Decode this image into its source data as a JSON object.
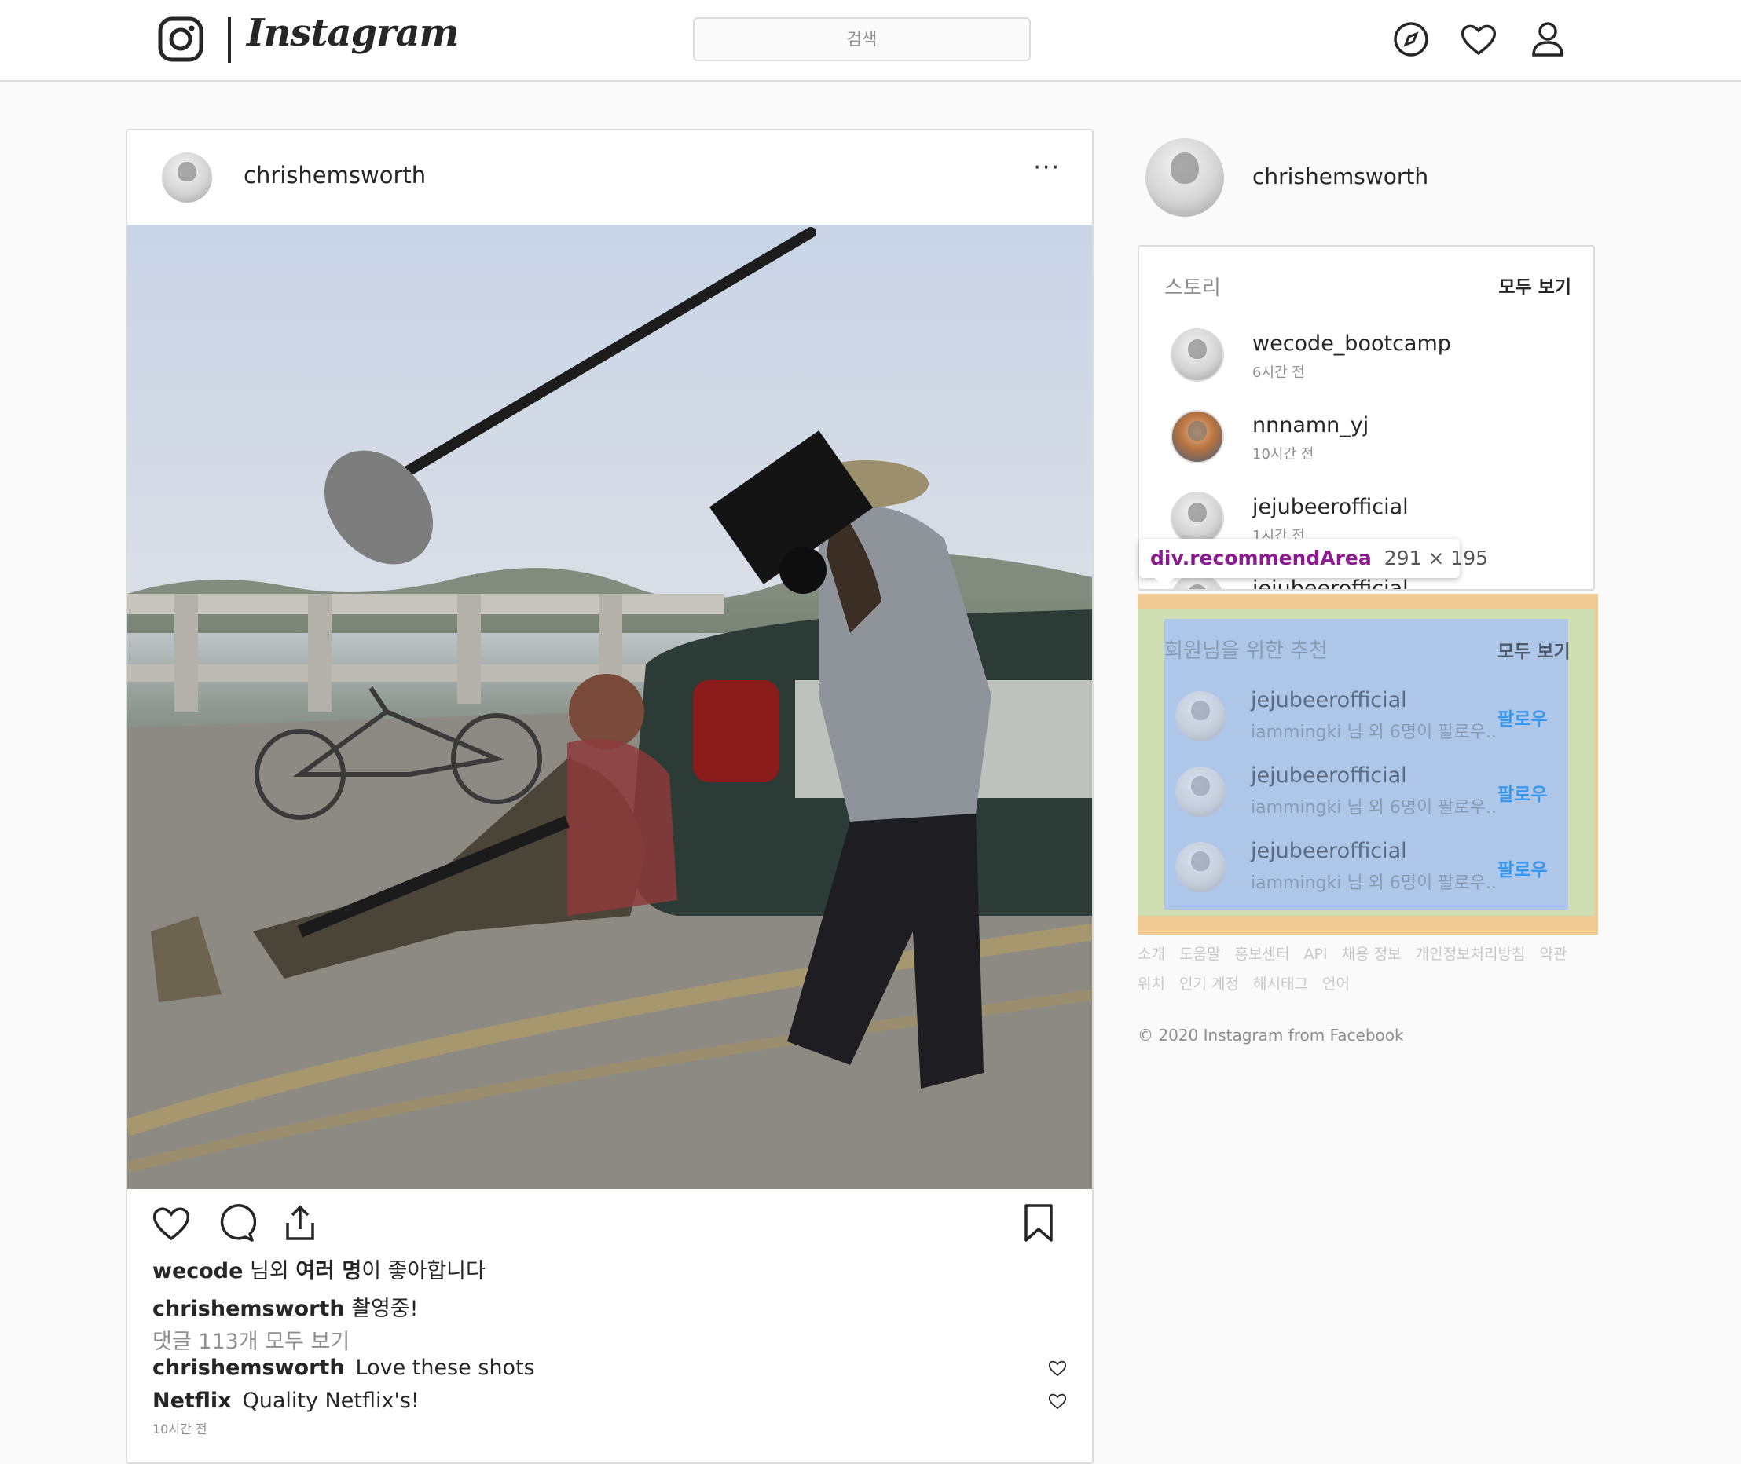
{
  "nav": {
    "logo_text": "Instagram",
    "search_placeholder": "검색",
    "icons": [
      "compass-icon",
      "heart-icon",
      "user-icon"
    ]
  },
  "feed": {
    "username": "chrishemsworth",
    "more": "···",
    "likes": {
      "user": "wecode",
      "mid": " 님외 ",
      "bold": "여러 명",
      "end": "이 좋아합니다"
    },
    "caption": {
      "user": "chrishemsworth",
      "text": " 촬영중!"
    },
    "view_comments": "댓글 113개 모두 보기",
    "comments": [
      {
        "user": "chrishemsworth",
        "text": "Love these shots"
      },
      {
        "user": "Netflix",
        "text": "Quality Netflix's!"
      }
    ],
    "time": "10시간 전"
  },
  "sidebar": {
    "username": "chrishemsworth",
    "stories": {
      "title": "스토리",
      "see_all": "모두 보기",
      "items": [
        {
          "name": "wecode_bootcamp",
          "time": "6시간 전"
        },
        {
          "name": "nnnamn_yj",
          "time": "10시간 전"
        },
        {
          "name": "jejubeerofficial",
          "time": "1시간 전"
        },
        {
          "name": "jejubeerofficial",
          "time": ""
        }
      ]
    },
    "tooltip": {
      "tag": "div.recommendArea",
      "dims": "291 × 195"
    },
    "recommend": {
      "title": "회원님을 위한 추천",
      "see_all": "모두 보기",
      "items": [
        {
          "name": "jejubeerofficial",
          "sub": "iammingki 님 외 6명이 팔로우..",
          "follow": "팔로우"
        },
        {
          "name": "jejubeerofficial",
          "sub": "iammingki 님 외 6명이 팔로우..",
          "follow": "팔로우"
        },
        {
          "name": "jejubeerofficial",
          "sub": "iammingki 님 외 6명이 팔로우..",
          "follow": "팔로우"
        }
      ]
    },
    "footer_links": [
      "소개",
      "도움말",
      "홍보센터",
      "API",
      "채용 정보",
      "개인정보처리방침",
      "약관",
      "위치",
      "인기 계정",
      "해시태그",
      "언어"
    ],
    "copyright": "© 2020 Instagram from Facebook"
  }
}
